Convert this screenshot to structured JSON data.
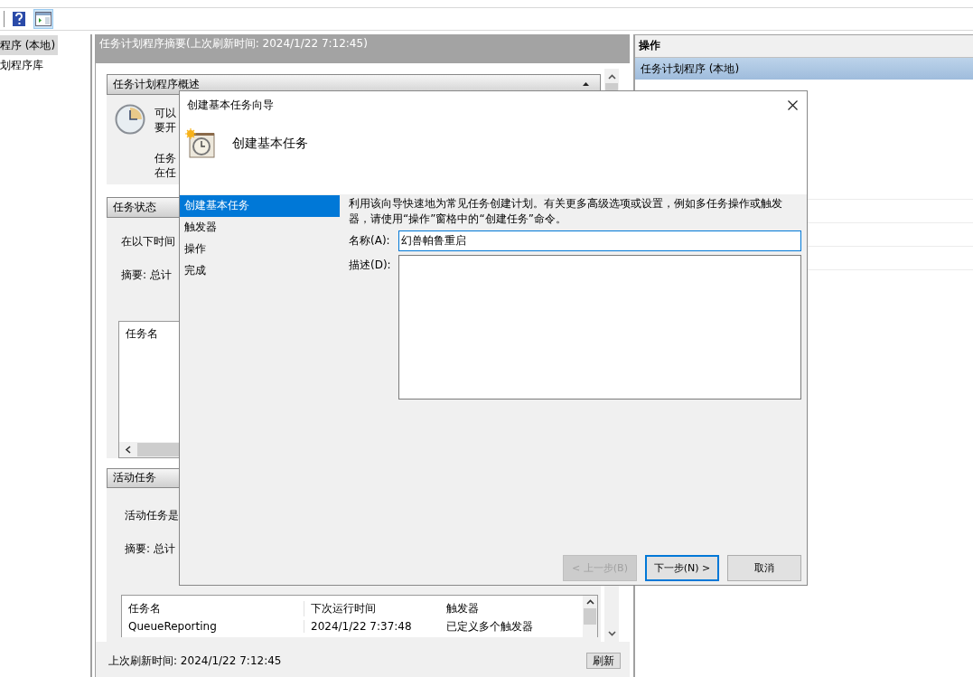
{
  "toolbar": [
    {
      "kind": "help",
      "pressed": false
    },
    {
      "kind": "show-pane",
      "pressed": true
    }
  ],
  "tree": [
    {
      "label": "程序 (本地)",
      "selected": true
    },
    {
      "label": "划程序库",
      "selected": false
    }
  ],
  "summary": {
    "title": "任务计划程序摘要(上次刷新时间: 2024/1/22 7:12:45)",
    "overview": {
      "title": "任务计划程序概述",
      "expanded": true,
      "lines": [
        "可以",
        "要开",
        "任务",
        "在任"
      ]
    },
    "status": {
      "title": "任务状态",
      "lines": [
        "在以下时间",
        "摘要: 总计"
      ],
      "columns": [
        "任务名"
      ]
    },
    "active": {
      "title": "活动任务",
      "lines": [
        "活动任务是",
        "摘要: 总计"
      ],
      "columns": [
        "任务名",
        "下次运行时间",
        "触发器"
      ],
      "rows": [
        [
          "QueueReporting",
          "2024/1/22 7:37:48",
          "已定义多个触发器"
        ]
      ]
    },
    "footer": "上次刷新时间: 2024/1/22 7:12:45",
    "refresh": "刷新"
  },
  "actions": {
    "title": "操作",
    "items": [
      {
        "kind": "group",
        "label": "任务计划程序 (本地)",
        "selected": true
      }
    ]
  },
  "dialog": {
    "title": "创建基本任务向导",
    "heading": "创建基本任务",
    "steps": [
      {
        "label": "创建基本任务",
        "selected": true
      },
      {
        "label": "触发器",
        "selected": false
      },
      {
        "label": "操作",
        "selected": false
      },
      {
        "label": "完成",
        "selected": false
      }
    ],
    "intro": "利用该向导快速地为常见任务创建计划。有关更多高级选项或设置，例如多任务操作或触发器，请使用“操作”窗格中的“创建任务”命令。",
    "name_label": "名称(A):",
    "name_value": "幻兽帕鲁重启",
    "name_focused": true,
    "desc_label": "描述(D):",
    "buttons": [
      {
        "label": "< 上一步(B)",
        "disabled": true,
        "focused": false
      },
      {
        "label": "下一步(N) >",
        "disabled": false,
        "focused": true
      },
      {
        "label": "取消",
        "disabled": false,
        "focused": false
      }
    ]
  }
}
